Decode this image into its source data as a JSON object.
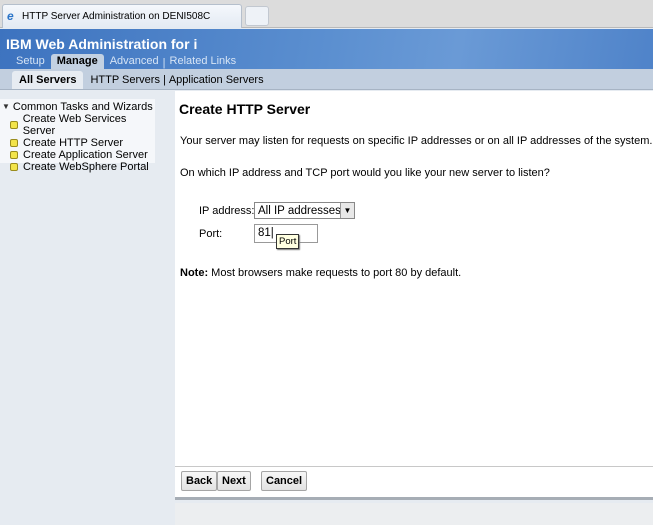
{
  "browser": {
    "tab_title": "HTTP Server Administration on DENI508C"
  },
  "header": {
    "title": "IBM Web Administration for i",
    "nav": [
      "Setup",
      "Manage",
      "Advanced",
      "Related Links"
    ]
  },
  "subnav": [
    "All Servers",
    "HTTP Servers",
    "Application Servers"
  ],
  "sidebar": {
    "heading": "Common Tasks and Wizards",
    "items": [
      "Create Web Services Server",
      "Create HTTP Server",
      "Create Application Server",
      "Create WebSphere Portal"
    ]
  },
  "main": {
    "title": "Create HTTP Server",
    "intro": "Your server may listen for requests on specific IP addresses or on all IP addresses of the system.",
    "question": "On which IP address and TCP port would you like your new server to listen?",
    "ip_label": "IP address:",
    "ip_value": "All IP addresses",
    "port_label": "Port:",
    "port_value": "81",
    "tooltip": "Port",
    "note_bold": "Note:",
    "note": " Most browsers make requests to port 80 by default."
  },
  "buttons": {
    "back": "Back",
    "next": "Next",
    "cancel": "Cancel"
  }
}
